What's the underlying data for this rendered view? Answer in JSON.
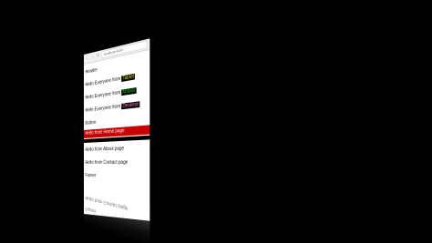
{
  "browser": {
    "address": "localhost:4200",
    "back_glyph": "←",
    "forward_glyph": "→",
    "reload_glyph": "↻"
  },
  "page": {
    "header": "Header",
    "greeting_prefix": "Hello Everyone from",
    "sources": [
      "Tablet",
      "Mobile",
      "Desktop"
    ],
    "button_label": "Button",
    "home_line": "Hello from Home page",
    "about_line": "Hello from About page",
    "contact_line": "Hello from Contact page",
    "footer": "Footer"
  },
  "colors": {
    "background": "#000000",
    "red_bar": "#c80000"
  }
}
